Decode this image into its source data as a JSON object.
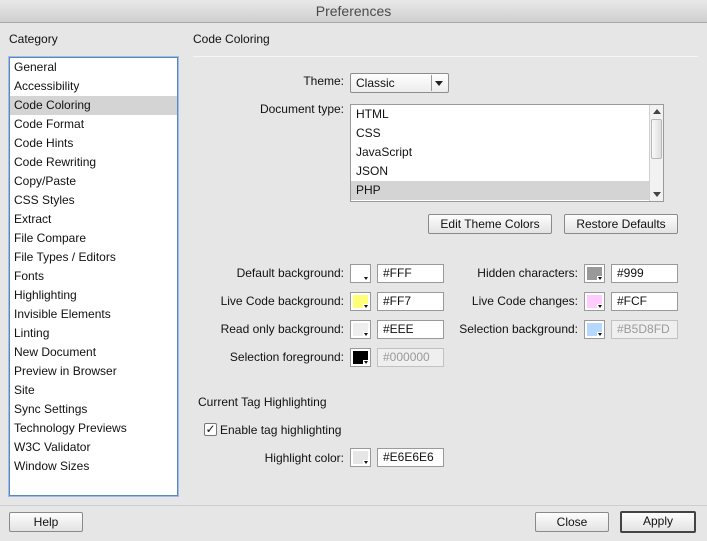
{
  "window": {
    "title": "Preferences"
  },
  "sidebar": {
    "label": "Category",
    "selected_index": 2,
    "items": [
      "General",
      "Accessibility",
      "Code Coloring",
      "Code Format",
      "Code Hints",
      "Code Rewriting",
      "Copy/Paste",
      "CSS Styles",
      "Extract",
      "File Compare",
      "File Types / Editors",
      "Fonts",
      "Highlighting",
      "Invisible Elements",
      "Linting",
      "New Document",
      "Preview in Browser",
      "Site",
      "Sync Settings",
      "Technology Previews",
      "W3C Validator",
      "Window Sizes"
    ]
  },
  "main": {
    "title": "Code Coloring",
    "theme": {
      "label": "Theme:",
      "value": "Classic"
    },
    "document_type": {
      "label": "Document type:",
      "selected_index": 4,
      "items": [
        "HTML",
        "CSS",
        "JavaScript",
        "JSON",
        "PHP"
      ]
    },
    "edit_theme_colors_label": "Edit Theme Colors",
    "restore_defaults_label": "Restore Defaults",
    "colors_left": [
      {
        "label": "Default background:",
        "hex": "#FFF",
        "color": "#FFFFFF",
        "disabled": false
      },
      {
        "label": "Live Code background:",
        "hex": "#FF7",
        "color": "#FFFF77",
        "disabled": false
      },
      {
        "label": "Read only background:",
        "hex": "#EEE",
        "color": "#EEEEEE",
        "disabled": false
      },
      {
        "label": "Selection foreground:",
        "hex": "#000000",
        "color": "#000000",
        "disabled": true
      }
    ],
    "colors_right": [
      {
        "label": "Hidden characters:",
        "hex": "#999",
        "color": "#999999",
        "disabled": false
      },
      {
        "label": "Live Code changes:",
        "hex": "#FCF",
        "color": "#FFCCFF",
        "disabled": false
      },
      {
        "label": "Selection background:",
        "hex": "#B5D8FD",
        "color": "#B5D8FD",
        "disabled": true
      }
    ],
    "tag_highlighting": {
      "title": "Current Tag Highlighting",
      "enable_label": "Enable tag highlighting",
      "enabled": true,
      "highlight_label": "Highlight color:",
      "highlight_hex": "#E6E6E6",
      "highlight_color": "#E6E6E6"
    }
  },
  "footer": {
    "help_label": "Help",
    "close_label": "Close",
    "apply_label": "Apply"
  }
}
